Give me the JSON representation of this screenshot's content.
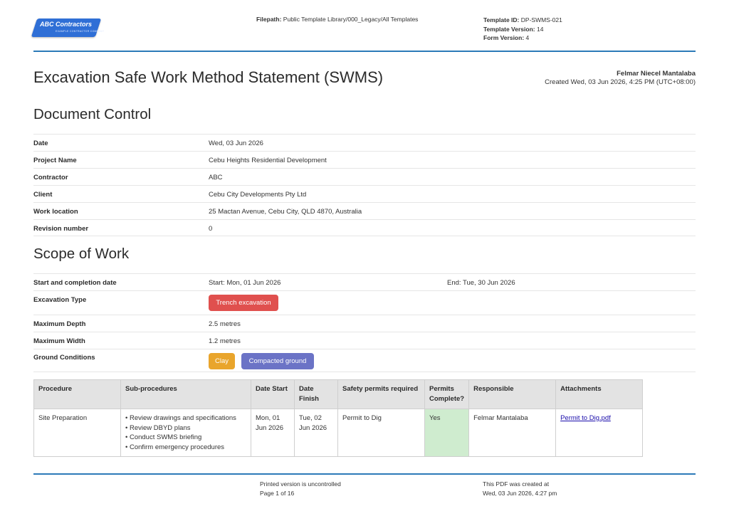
{
  "header": {
    "logo_text": "ABC Contractors",
    "logo_subtext": "EXAMPLE CONTRACTOR COMPANY",
    "filepath_label": "Filepath:",
    "filepath_value": "Public Template Library/000_Legacy/All Templates",
    "template_id_label": "Template ID:",
    "template_id_value": "DP-SWMS-021",
    "template_version_label": "Template Version:",
    "template_version_value": "14",
    "form_version_label": "Form Version:",
    "form_version_value": "4"
  },
  "title": "Excavation Safe Work Method Statement (SWMS)",
  "author": {
    "name": "Felmar Niecel Mantalaba",
    "created": "Created Wed, 03 Jun 2026, 4:25 PM (UTC+08:00)"
  },
  "document_control": {
    "heading": "Document Control",
    "rows": [
      {
        "label": "Date",
        "value": "Wed, 03 Jun 2026"
      },
      {
        "label": "Project Name",
        "value": "Cebu Heights Residential Development"
      },
      {
        "label": "Contractor",
        "value": "ABC"
      },
      {
        "label": "Client",
        "value": "Cebu City Developments Pty Ltd"
      },
      {
        "label": "Work location",
        "value": "25 Mactan Avenue, Cebu City, QLD 4870, Australia"
      },
      {
        "label": "Revision number",
        "value": "0"
      }
    ]
  },
  "scope": {
    "heading": "Scope of Work",
    "dates_label": "Start and completion date",
    "start": "Start: Mon, 01 Jun 2026",
    "end": "End: Tue, 30 Jun 2026",
    "excavation_label": "Excavation Type",
    "excavation_value": "Trench excavation",
    "depth_label": "Maximum Depth",
    "depth_value": "2.5 metres",
    "width_label": "Maximum Width",
    "width_value": "1.2 metres",
    "ground_label": "Ground Conditions",
    "ground_values": [
      "Clay",
      "Compacted ground"
    ]
  },
  "colors": {
    "trench": "#e0504e",
    "clay": "#e9a52c",
    "compacted": "#6b73c6",
    "rule": "#2c7ab8",
    "permit_ok": "#cfeccf"
  },
  "table": {
    "headers": [
      "Procedure",
      "Sub-procedures",
      "Date Start",
      "Date Finish",
      "Safety permits required",
      "Permits Complete?",
      "Responsible",
      "Attachments"
    ],
    "rows": [
      {
        "procedure": "Site Preparation",
        "subs": [
          "• Review drawings and specifications",
          "• Review DBYD plans",
          "• Conduct SWMS briefing",
          "• Confirm emergency procedures"
        ],
        "date_start": "Mon, 01 Jun 2026",
        "date_finish": "Tue, 02 Jun 2026",
        "permits": "Permit to Dig",
        "complete": "Yes",
        "responsible": "Felmar Mantalaba",
        "attachment": "Permit to Dig.pdf"
      }
    ]
  },
  "footer": {
    "uncontrolled": "Printed version is uncontrolled",
    "page": "Page 1 of 16",
    "created_line1": "This PDF was created at",
    "created_line2": "Wed, 03 Jun 2026, 4:27 pm"
  }
}
